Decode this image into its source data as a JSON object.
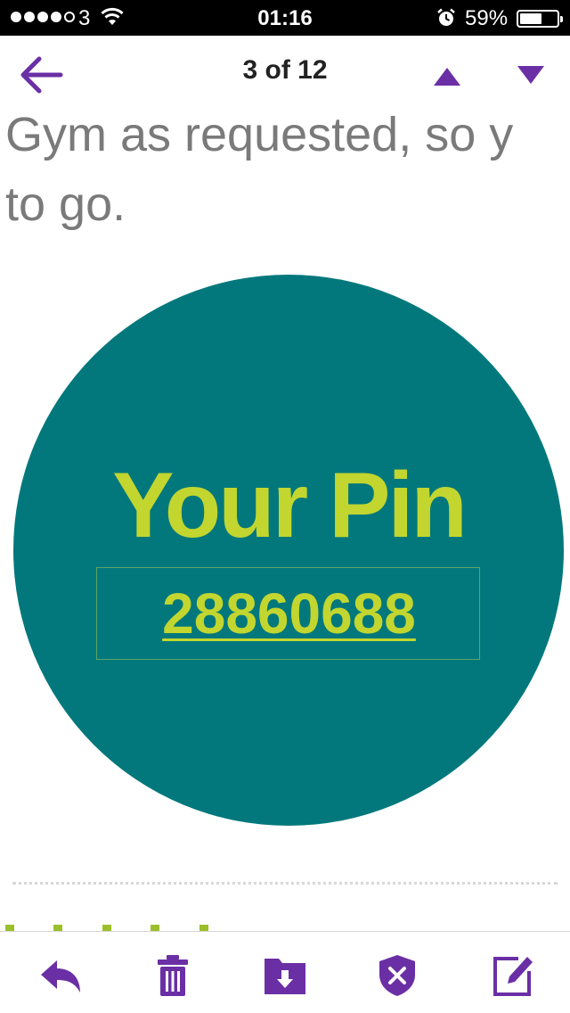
{
  "status_bar": {
    "carrier": "3",
    "time": "01:16",
    "battery_percent": "59%",
    "battery_level": 0.59,
    "signal_bars_filled": 4,
    "signal_bars_total": 5
  },
  "nav": {
    "position": "3 of 12"
  },
  "message": {
    "line1": "Gym as requested, so y",
    "line2": "to go.",
    "pin_title": "Your Pin",
    "pin_number": "28860688"
  },
  "colors": {
    "accent": "#6b2fa5",
    "pin_background": "#02787c",
    "pin_text": "#c2d62f",
    "body_text": "#7a7a7a"
  },
  "toolbar": {
    "icons": [
      "reply-icon",
      "trash-icon",
      "move-to-folder-icon",
      "spam-icon",
      "compose-icon"
    ]
  }
}
